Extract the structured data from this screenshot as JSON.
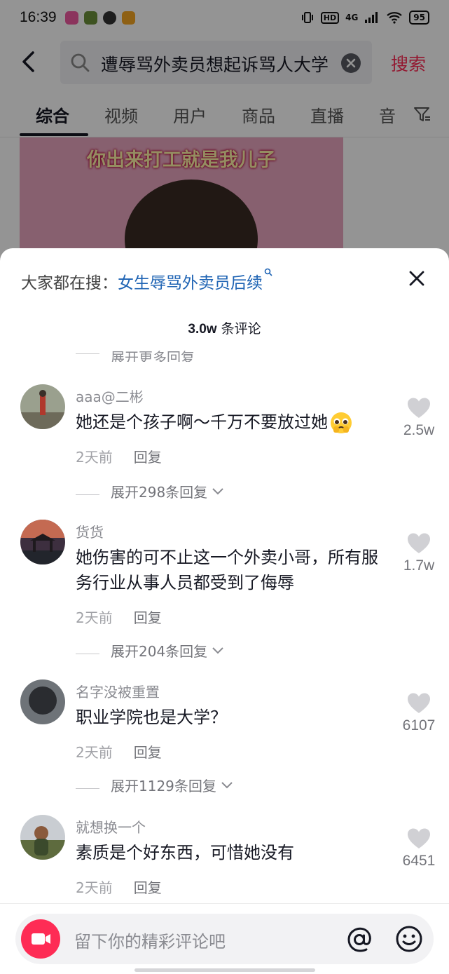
{
  "status_bar": {
    "time": "16:39",
    "network": "4G",
    "hd": "HD",
    "battery": "95"
  },
  "search": {
    "query": "遭辱骂外卖员想起诉骂人大学",
    "button_label": "搜索"
  },
  "tabs": [
    {
      "label": "综合",
      "active": true
    },
    {
      "label": "视频",
      "active": false
    },
    {
      "label": "用户",
      "active": false
    },
    {
      "label": "商品",
      "active": false
    },
    {
      "label": "直播",
      "active": false
    },
    {
      "label": "音",
      "active": false
    }
  ],
  "video": {
    "caption": "你出来打工就是我儿子"
  },
  "sheet": {
    "trend_prefix": "大家都在搜：",
    "trend_link": "女生辱骂外卖员后续",
    "count_number": "3.0w",
    "count_suffix": " 条评论",
    "partial_expand": "展开更多回复"
  },
  "comments": [
    {
      "user": "aaa@二彬",
      "text": "她还是个孩子啊～千万不要放过她",
      "time": "2天前",
      "reply": "回复",
      "likes": "2.5w",
      "expand": "展开298条回复",
      "emoji": "pleading-face-icon"
    },
    {
      "user": "货货",
      "text": "她伤害的可不止这一个外卖小哥，所有服务行业从事人员都受到了侮辱",
      "time": "2天前",
      "reply": "回复",
      "likes": "1.7w",
      "expand": "展开204条回复"
    },
    {
      "user": "名字没被重置",
      "text": "职业学院也是大学？",
      "time": "2天前",
      "reply": "回复",
      "likes": "6107",
      "expand": "展开1129条回复"
    },
    {
      "user": "就想换一个",
      "text": "素质是个好东西，可惜她没有",
      "time": "2天前",
      "reply": "回复",
      "likes": "6451"
    }
  ],
  "input": {
    "placeholder": "留下你的精彩评论吧"
  },
  "colors": {
    "accent": "#fe2c55",
    "link": "#1f64b4",
    "secondary_text": "#8a8b91"
  }
}
